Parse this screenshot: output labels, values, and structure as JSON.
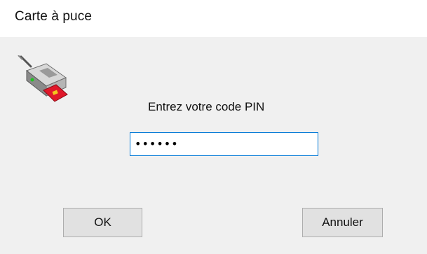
{
  "window": {
    "title": "Carte à puce"
  },
  "dialog": {
    "icon": "smart-card-reader-icon",
    "prompt": "Entrez votre code PIN",
    "pin_value": "••••••",
    "ok_label": "OK",
    "cancel_label": "Annuler"
  },
  "colors": {
    "dialog_background": "#f0f0f0",
    "input_focus_border": "#0078d7",
    "button_background": "#e1e1e1",
    "button_border": "#adadad"
  }
}
